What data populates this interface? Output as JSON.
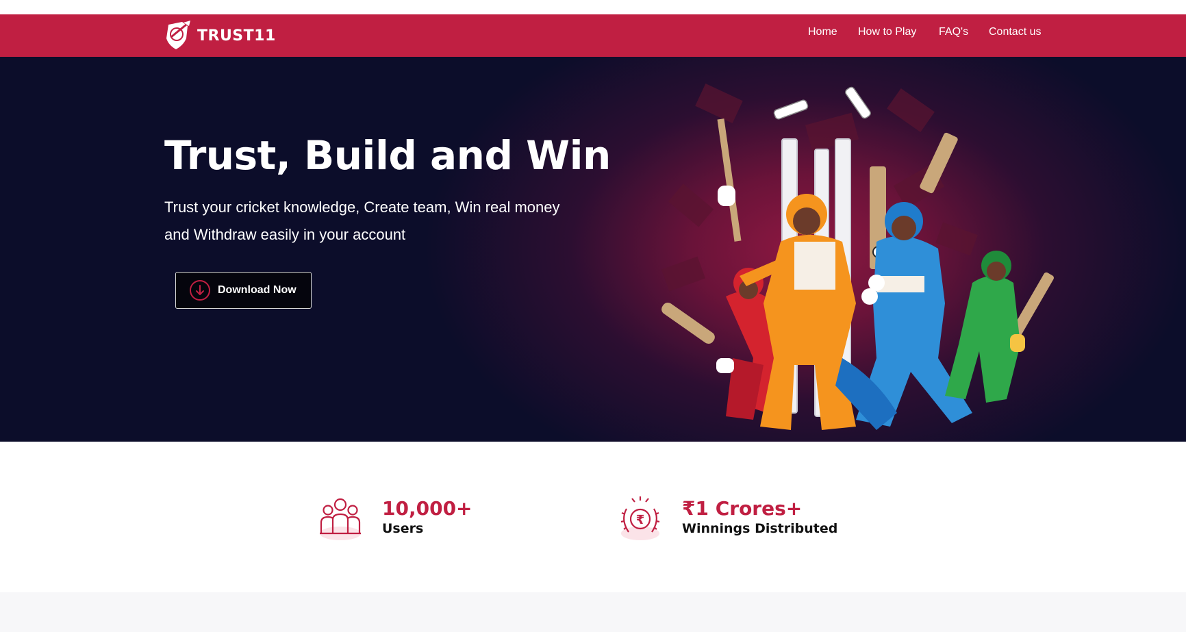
{
  "brand": {
    "name": "TRUST11",
    "primary_color": "#c01f42",
    "hero_bg": "#0c0d2a"
  },
  "nav": {
    "items": [
      {
        "label": "Home"
      },
      {
        "label": "How to Play"
      },
      {
        "label": "FAQ's"
      },
      {
        "label": "Contact us"
      }
    ]
  },
  "hero": {
    "title": "Trust, Build and Win",
    "subtitle": "Trust your cricket knowledge, Create team, Win real money and Withdraw easily in your account",
    "download_label": "Download Now",
    "download_icon": "arrow-down-circle-icon",
    "illustration": "cricket-players-illustration"
  },
  "stats": [
    {
      "value": "10,000+",
      "label": "Users",
      "icon": "users-group-icon"
    },
    {
      "value": "₹1 Crores+",
      "label": "Winnings Distributed",
      "icon": "rupee-laurel-icon"
    }
  ]
}
